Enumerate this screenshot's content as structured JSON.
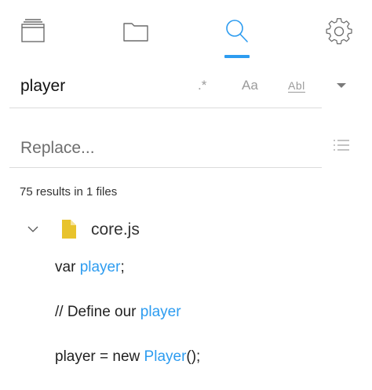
{
  "toolbar": {
    "tabs": [
      {
        "name": "open-editors",
        "icon": "stacked-windows-icon"
      },
      {
        "name": "explorer",
        "icon": "folder-icon"
      },
      {
        "name": "search",
        "icon": "search-icon",
        "active": true
      },
      {
        "name": "settings",
        "icon": "gear-icon"
      }
    ],
    "accent_color": "#2d9cf0"
  },
  "search": {
    "value": "player",
    "options": {
      "regex_label": ".*",
      "case_label": "Aa",
      "word_label": "Abl"
    }
  },
  "replace": {
    "placeholder": "Replace..."
  },
  "results": {
    "summary": "75 results in 1 files",
    "file": {
      "name": "core.js",
      "icon": "file-icon",
      "icon_color": "#e8c32c"
    },
    "matches": [
      {
        "before": "var ",
        "match": "player",
        "after": ";"
      },
      {
        "before": "// Define our ",
        "match": "player",
        "after": ""
      },
      {
        "before": "player = new ",
        "match": "Player",
        "after": "();"
      }
    ]
  }
}
